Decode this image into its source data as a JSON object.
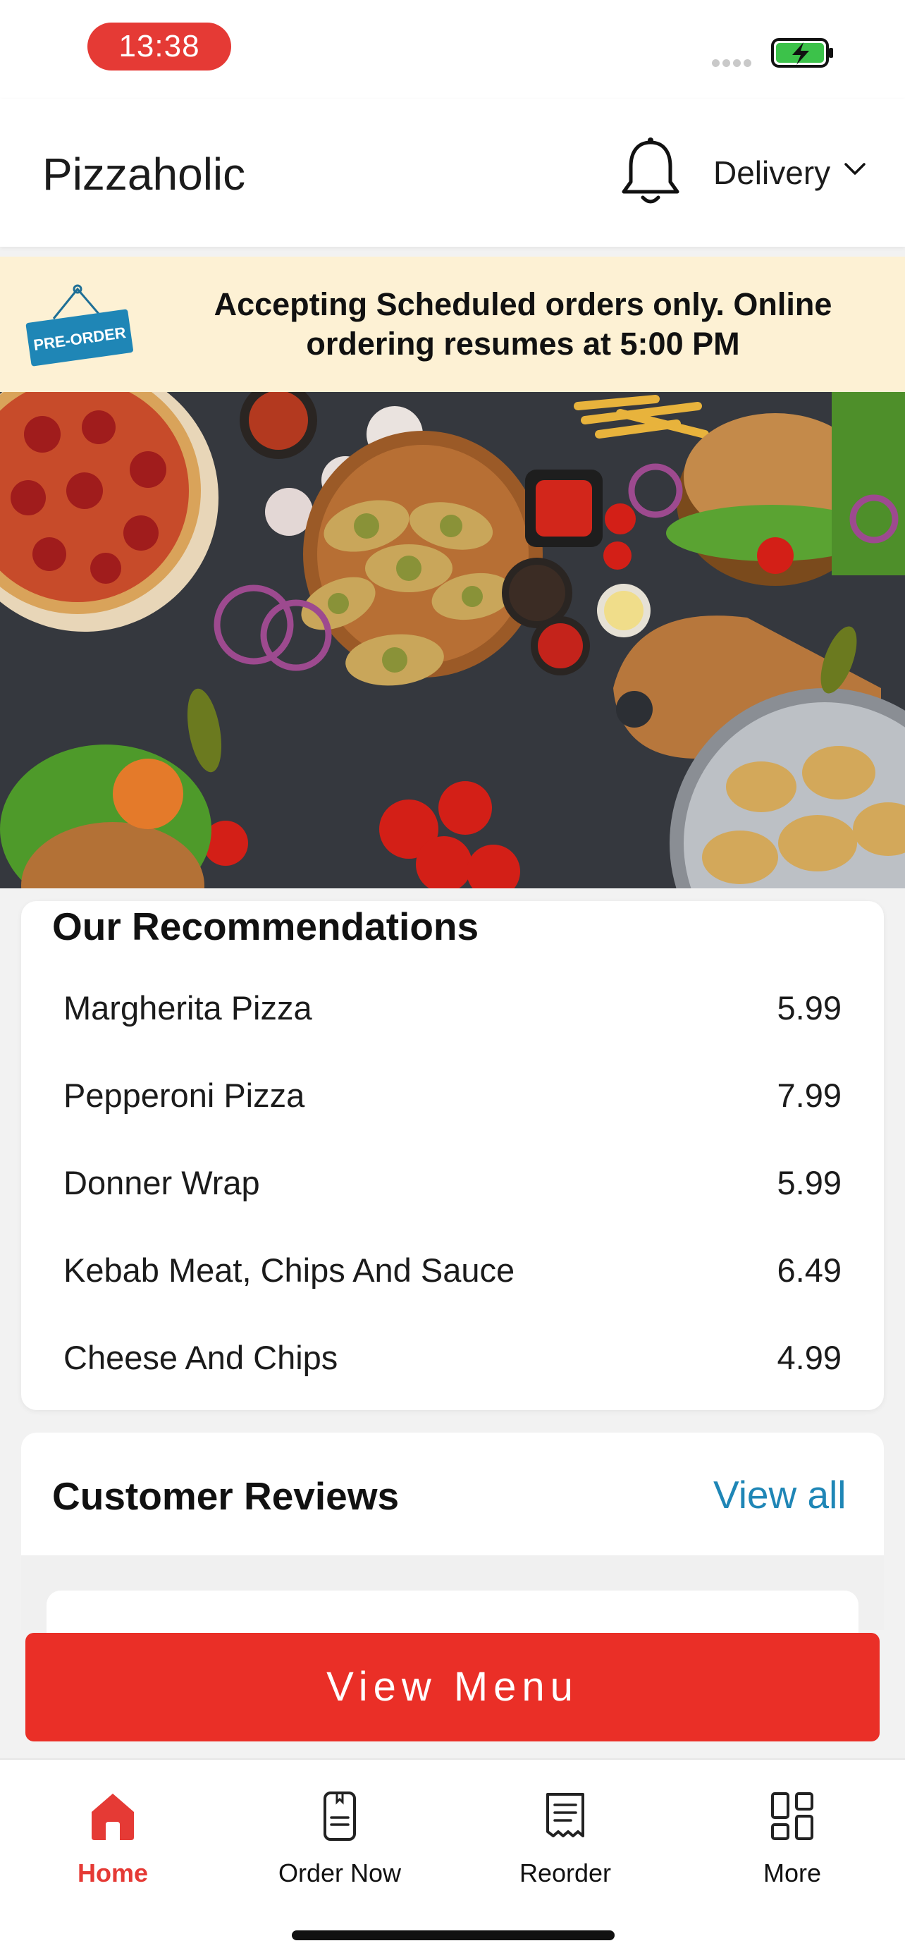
{
  "status_bar": {
    "time": "13:38"
  },
  "header": {
    "title": "Pizzaholic",
    "mode": "Delivery"
  },
  "notice": {
    "tag": "PRE-ORDER",
    "message": "Accepting Scheduled orders only. Online ordering resumes at 5:00 PM"
  },
  "recommendations": {
    "title": "Our Recommendations",
    "items": [
      {
        "name": "Margherita Pizza",
        "price": "5.99"
      },
      {
        "name": "Pepperoni Pizza",
        "price": "7.99"
      },
      {
        "name": "Donner Wrap",
        "price": "5.99"
      },
      {
        "name": "Kebab Meat, Chips And Sauce",
        "price": "6.49"
      },
      {
        "name": "Cheese And Chips",
        "price": "4.99"
      }
    ]
  },
  "reviews": {
    "title": "Customer Reviews",
    "view_all": "View all"
  },
  "cta": {
    "label": "View Menu"
  },
  "nav": {
    "items": [
      {
        "label": "Home",
        "icon": "home-icon",
        "active": true
      },
      {
        "label": "Order Now",
        "icon": "order-icon",
        "active": false
      },
      {
        "label": "Reorder",
        "icon": "receipt-icon",
        "active": false
      },
      {
        "label": "More",
        "icon": "grid-icon",
        "active": false
      }
    ]
  },
  "colors": {
    "accent": "#ea2f27",
    "link": "#1f86b6",
    "notice_bg": "#fdf1d4",
    "tag_blue": "#1f86b6"
  }
}
